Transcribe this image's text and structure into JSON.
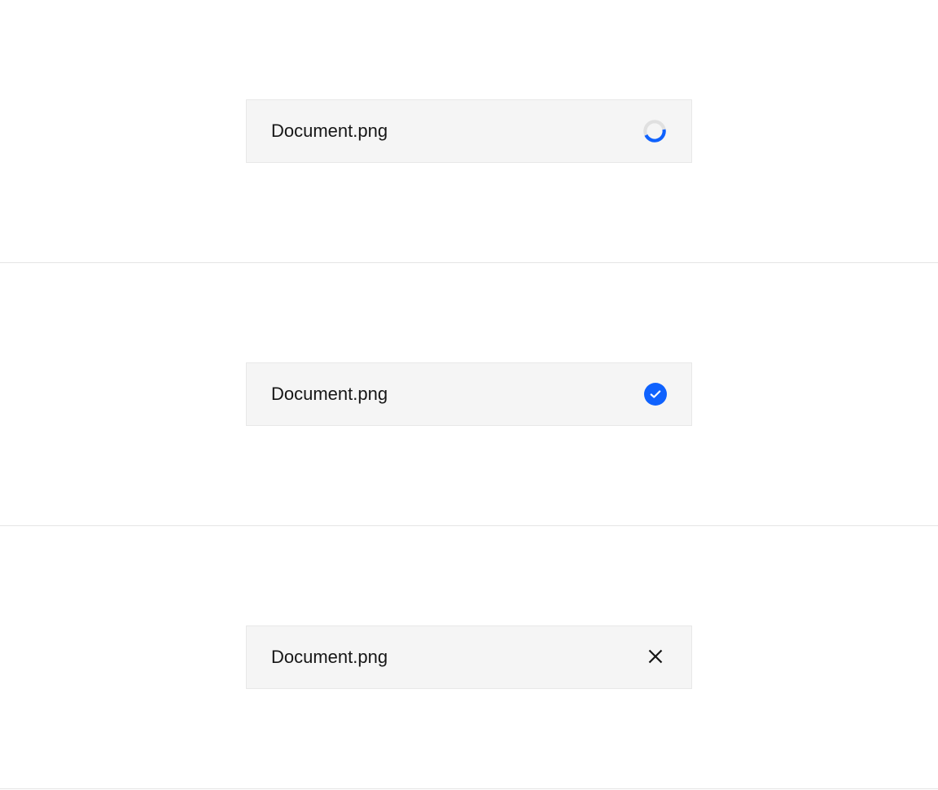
{
  "items": [
    {
      "filename": "Document.png",
      "state": "loading"
    },
    {
      "filename": "Document.png",
      "state": "success"
    },
    {
      "filename": "Document.png",
      "state": "closable"
    }
  ],
  "colors": {
    "accent": "#0f62fe",
    "spinner_track": "#e0e0e0",
    "card_bg": "#f5f5f5",
    "text": "#161616"
  }
}
